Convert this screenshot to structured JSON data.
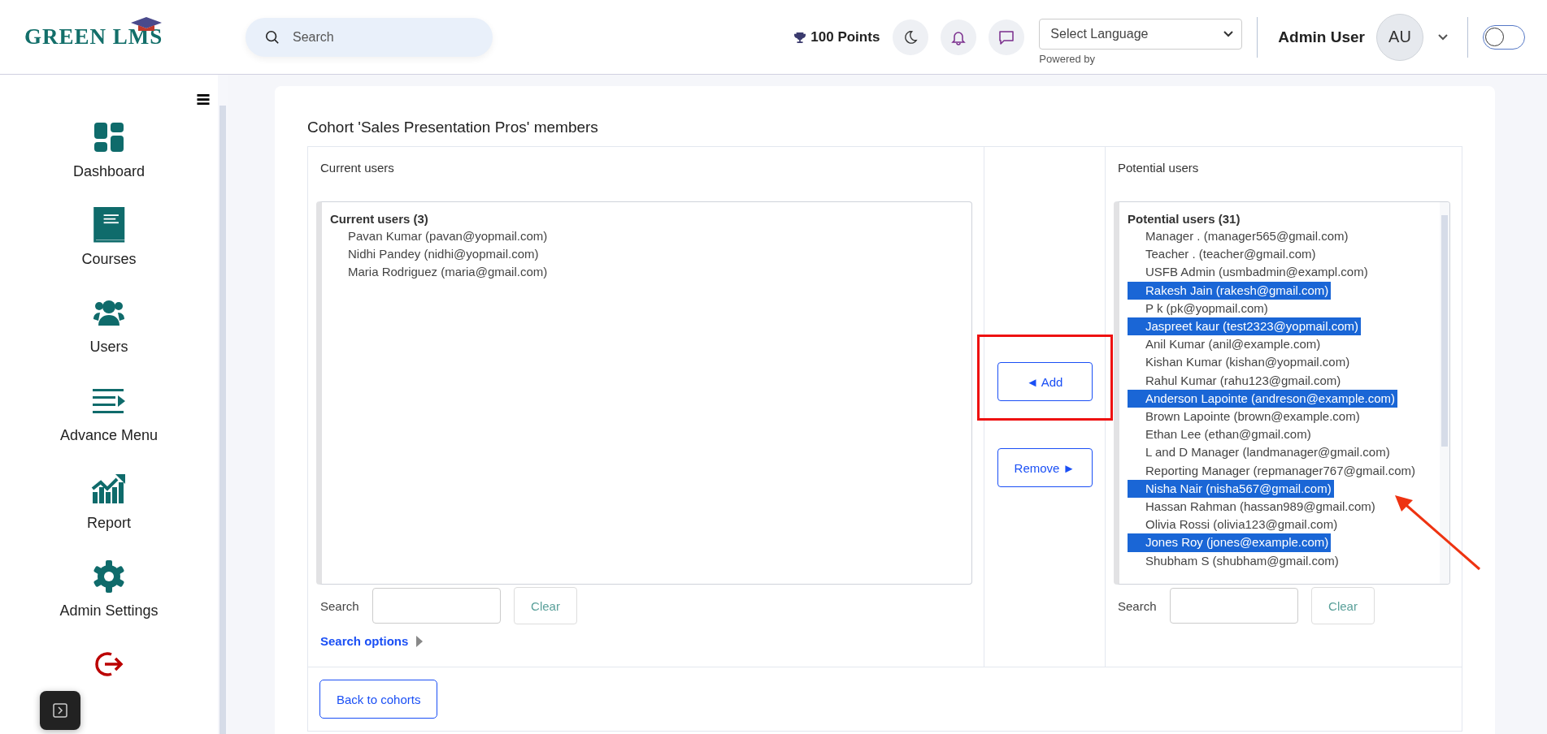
{
  "header": {
    "logo": "GREEN LMS",
    "search": {
      "placeholder": "Search"
    },
    "points": "100 Points",
    "language": {
      "value": "Select Language",
      "powered_by": "Powered by"
    },
    "user": {
      "name": "Admin User",
      "initials": "AU"
    },
    "theme_toggle": {
      "on": false
    }
  },
  "sidebar": {
    "items": [
      {
        "kind": "dashboard",
        "label": "Dashboard"
      },
      {
        "kind": "courses",
        "label": "Courses"
      },
      {
        "kind": "users",
        "label": "Users"
      },
      {
        "kind": "menu",
        "label": "Advance Menu"
      },
      {
        "kind": "report",
        "label": "Report"
      },
      {
        "kind": "settings",
        "label": "Admin Settings"
      },
      {
        "kind": "logout"
      }
    ]
  },
  "page": {
    "title": "Cohort 'Sales Presentation Pros' members",
    "current": {
      "heading": "Current users",
      "group": "Current users (3)",
      "users": [
        {
          "label": "Pavan Kumar (pavan@yopmail.com)",
          "selected": false
        },
        {
          "label": "Nidhi Pandey (nidhi@yopmail.com)",
          "selected": false
        },
        {
          "label": "Maria Rodriguez (maria@gmail.com)",
          "selected": false
        }
      ],
      "search_label": "Search",
      "clear": "Clear",
      "search_options": "Search options"
    },
    "buttons": {
      "add": "◄ Add",
      "remove": "Remove ►"
    },
    "potential": {
      "heading": "Potential users",
      "group": "Potential users (31)",
      "users": [
        {
          "label": "Manager . (manager565@gmail.com)",
          "selected": false
        },
        {
          "label": "Teacher . (teacher@gmail.com)",
          "selected": false
        },
        {
          "label": "USFB Admin (usmbadmin@exampl.com)",
          "selected": false
        },
        {
          "label": "Rakesh Jain (rakesh@gmail.com)",
          "selected": true
        },
        {
          "label": "P k (pk@yopmail.com)",
          "selected": false
        },
        {
          "label": "Jaspreet kaur (test2323@yopmail.com)",
          "selected": true
        },
        {
          "label": "Anil Kumar (anil@example.com)",
          "selected": false
        },
        {
          "label": "Kishan Kumar (kishan@yopmail.com)",
          "selected": false
        },
        {
          "label": "Rahul Kumar (rahu123@gmail.com)",
          "selected": false
        },
        {
          "label": "Anderson Lapointe (andreson@example.com)",
          "selected": true
        },
        {
          "label": "Brown Lapointe (brown@example.com)",
          "selected": false
        },
        {
          "label": "Ethan Lee (ethan@gmail.com)",
          "selected": false
        },
        {
          "label": "L and D Manager (landmanager@gmail.com)",
          "selected": false
        },
        {
          "label": "Reporting Manager (repmanager767@gmail.com)",
          "selected": false
        },
        {
          "label": "Nisha Nair (nisha567@gmail.com)",
          "selected": true
        },
        {
          "label": "Hassan Rahman (hassan989@gmail.com)",
          "selected": false
        },
        {
          "label": "Olivia Rossi (olivia123@gmail.com)",
          "selected": false
        },
        {
          "label": "Jones Roy (jones@example.com)",
          "selected": true
        },
        {
          "label": "Shubham S (shubham@gmail.com)",
          "selected": false
        }
      ],
      "search_label": "Search",
      "clear": "Clear"
    },
    "back": "Back to cohorts"
  }
}
